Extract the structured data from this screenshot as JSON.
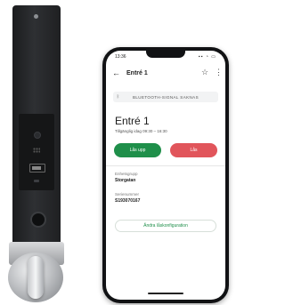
{
  "status_bar": {
    "time": "13:36",
    "icons": "▪▪ ◔ ▭"
  },
  "app_bar": {
    "title": "Entré 1"
  },
  "bluetooth": {
    "label": "BLUETOOTH-SIGNAL SAKNAS"
  },
  "door": {
    "name": "Entré 1",
    "schedule": "Tillgänglig idag 09:30 – 16:30"
  },
  "actions": {
    "unlock": "Lås upp",
    "lock": "Lås"
  },
  "details": {
    "group_label": "Enhetsgrupp",
    "group_value": "Storgatan",
    "serial_label": "Serienummer",
    "serial_value": "S193070167"
  },
  "config_button": "Ändra låskonfiguration",
  "colors": {
    "unlock": "#1f8f4a",
    "lock": "#e1555b",
    "accent": "#1f8f4a"
  }
}
